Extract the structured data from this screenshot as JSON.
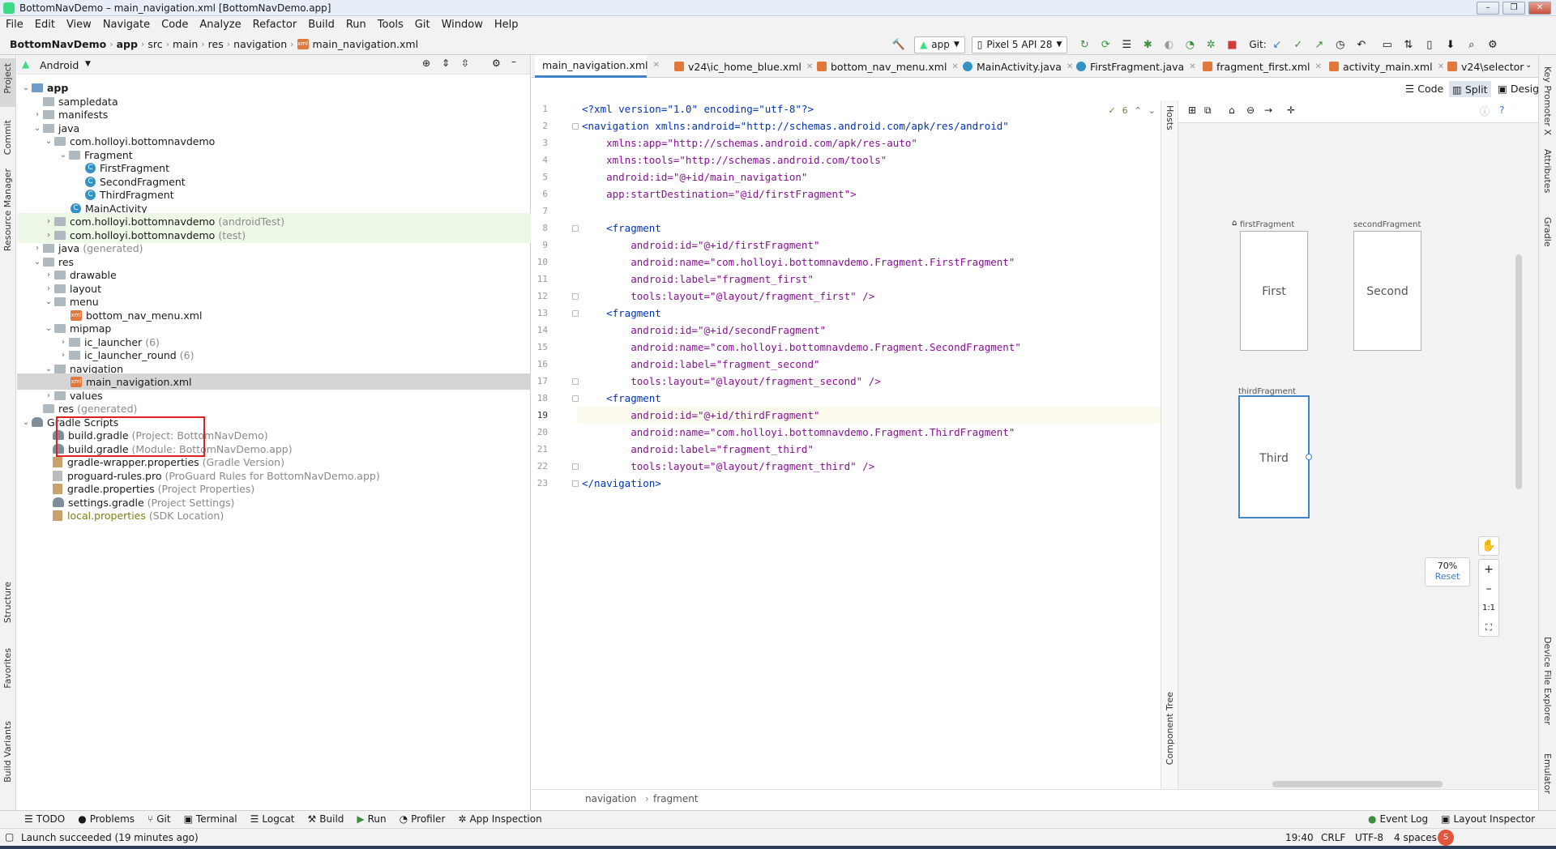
{
  "window": {
    "title": "BottomNavDemo – main_navigation.xml [BottomNavDemo.app]"
  },
  "menu": [
    "File",
    "Edit",
    "View",
    "Navigate",
    "Code",
    "Analyze",
    "Refactor",
    "Build",
    "Run",
    "Tools",
    "Git",
    "Window",
    "Help"
  ],
  "breadcrumb": [
    "BottomNavDemo",
    "app",
    "src",
    "main",
    "res",
    "navigation",
    "main_navigation.xml"
  ],
  "toolbar": {
    "run_config": "app",
    "device": "Pixel 5 API 28",
    "git_label": "Git:"
  },
  "left_strip": [
    "Project",
    "Commit",
    "Resource Manager",
    "Structure",
    "Favorites",
    "Build Variants"
  ],
  "right_strip": [
    "Key Promoter X",
    "Attributes",
    "Gradle",
    "Device File Explorer",
    "Emulator"
  ],
  "project": {
    "view": "Android",
    "tree": [
      {
        "label": "app",
        "extra": ""
      },
      {
        "label": "sampledata",
        "extra": ""
      },
      {
        "label": "manifests",
        "extra": ""
      },
      {
        "label": "java",
        "extra": ""
      },
      {
        "label": "com.holloyi.bottomnavdemo",
        "extra": ""
      },
      {
        "label": "Fragment",
        "extra": ""
      },
      {
        "label": "FirstFragment",
        "extra": ""
      },
      {
        "label": "SecondFragment",
        "extra": ""
      },
      {
        "label": "ThirdFragment",
        "extra": ""
      },
      {
        "label": "MainActivity",
        "extra": ""
      },
      {
        "label": "com.holloyi.bottomnavdemo",
        "extra": "(androidTest)"
      },
      {
        "label": "com.holloyi.bottomnavdemo",
        "extra": "(test)"
      },
      {
        "label": "java",
        "extra": "(generated)"
      },
      {
        "label": "res",
        "extra": ""
      },
      {
        "label": "drawable",
        "extra": ""
      },
      {
        "label": "layout",
        "extra": ""
      },
      {
        "label": "menu",
        "extra": ""
      },
      {
        "label": "bottom_nav_menu.xml",
        "extra": ""
      },
      {
        "label": "mipmap",
        "extra": ""
      },
      {
        "label": "ic_launcher",
        "extra": "(6)"
      },
      {
        "label": "ic_launcher_round",
        "extra": "(6)"
      },
      {
        "label": "navigation",
        "extra": ""
      },
      {
        "label": "main_navigation.xml",
        "extra": ""
      },
      {
        "label": "values",
        "extra": ""
      },
      {
        "label": "res",
        "extra": "(generated)"
      },
      {
        "label": "Gradle Scripts",
        "extra": ""
      },
      {
        "label": "build.gradle",
        "extra": "(Project: BottomNavDemo)"
      },
      {
        "label": "build.gradle",
        "extra": "(Module: BottomNavDemo.app)"
      },
      {
        "label": "gradle-wrapper.properties",
        "extra": "(Gradle Version)"
      },
      {
        "label": "proguard-rules.pro",
        "extra": "(ProGuard Rules for BottomNavDemo.app)"
      },
      {
        "label": "gradle.properties",
        "extra": "(Project Properties)"
      },
      {
        "label": "settings.gradle",
        "extra": "(Project Settings)"
      },
      {
        "label": "local.properties",
        "extra": "(SDK Location)"
      }
    ]
  },
  "tabs": [
    "main_navigation.xml",
    "v24\\ic_home_blue.xml",
    "bottom_nav_menu.xml",
    "MainActivity.java",
    "FirstFragment.java",
    "fragment_first.xml",
    "activity_main.xml",
    "v24\\selector"
  ],
  "view_modes": [
    "Code",
    "Split",
    "Design"
  ],
  "editor": {
    "inspections": "6",
    "lines": [
      "<?xml version=\"1.0\" encoding=\"utf-8\"?>",
      "<navigation xmlns:android=\"http://schemas.android.com/apk/res/android\"",
      "    xmlns:app=\"http://schemas.android.com/apk/res-auto\"",
      "    xmlns:tools=\"http://schemas.android.com/tools\"",
      "    android:id=\"@+id/main_navigation\"",
      "    app:startDestination=\"@id/firstFragment\">",
      "",
      "    <fragment",
      "        android:id=\"@+id/firstFragment\"",
      "        android:name=\"com.holloyi.bottomnavdemo.Fragment.FirstFragment\"",
      "        android:label=\"fragment_first\"",
      "        tools:layout=\"@layout/fragment_first\" />",
      "    <fragment",
      "        android:id=\"@+id/secondFragment\"",
      "        android:name=\"com.holloyi.bottomnavdemo.Fragment.SecondFragment\"",
      "        android:label=\"fragment_second\"",
      "        tools:layout=\"@layout/fragment_second\" />",
      "    <fragment",
      "        android:id=\"@+id/thirdFragment\"",
      "        android:name=\"com.holloyi.bottomnavdemo.Fragment.ThirdFragment\"",
      "        android:label=\"fragment_third\"",
      "        tools:layout=\"@layout/fragment_third\" />",
      "</navigation>"
    ],
    "breadcrumb": [
      "navigation",
      "fragment"
    ]
  },
  "design": {
    "hosts_label": "Hosts",
    "component_tree_label": "Component Tree",
    "destinations": [
      {
        "id": "firstFragment",
        "text": "First"
      },
      {
        "id": "secondFragment",
        "text": "Second"
      },
      {
        "id": "thirdFragment",
        "text": "Third"
      }
    ],
    "zoom": "70%",
    "reset": "Reset",
    "one_to_one": "1:1"
  },
  "bottom_tools": [
    "TODO",
    "Problems",
    "Git",
    "Terminal",
    "Logcat",
    "Build",
    "Run",
    "Profiler",
    "App Inspection"
  ],
  "bottom_right_tools": [
    "Event Log",
    "Layout Inspector"
  ],
  "status": {
    "message": "Launch succeeded (19 minutes ago)",
    "position": "19:40",
    "line_sep": "CRLF",
    "encoding": "UTF-8",
    "indent": "4 spaces"
  },
  "colors": {
    "accent": "#4083c9",
    "selection_red": "#e02020",
    "tag": "#0033b3",
    "attr": "#871094",
    "value": "#067d17"
  }
}
